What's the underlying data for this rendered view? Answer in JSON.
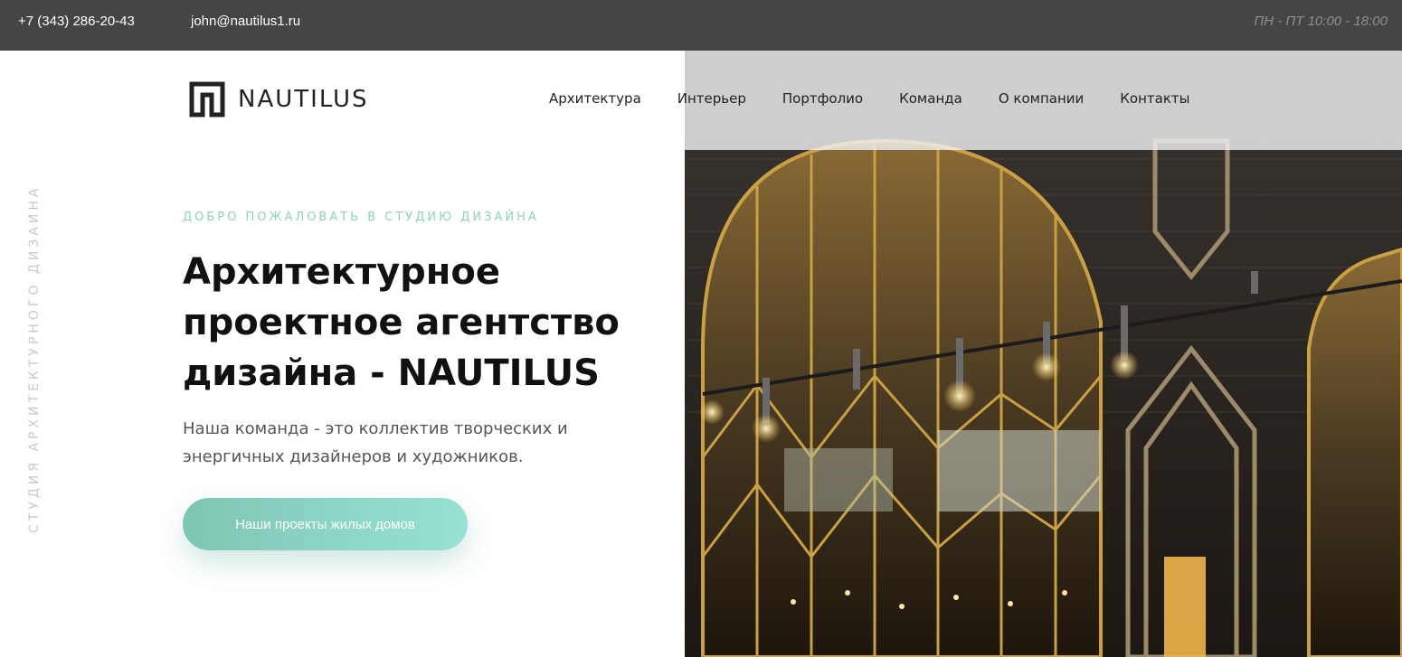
{
  "topbar": {
    "phone": "+7 (343) 286-20-43",
    "email": "john@nautilus1.ru",
    "hours": "ПН - ПТ 10:00 - 18:00"
  },
  "brand": {
    "name": "NAUTILUS",
    "accent_color": "#8ed1c2",
    "topbar_color": "#454545"
  },
  "nav": {
    "items": [
      {
        "label": "Архитектура"
      },
      {
        "label": "Интерьер"
      },
      {
        "label": "Портфолио"
      },
      {
        "label": "Команда"
      },
      {
        "label": "О компании"
      },
      {
        "label": "Контакты"
      }
    ]
  },
  "side": {
    "vertical_text": "СТУДИЯ АРХИТЕКТУРНОГО ДИЗАЙНА"
  },
  "hero": {
    "eyebrow": "ДОБРО ПОЖАЛОВАТЬ В СТУДИЮ ДИЗАЙНА",
    "headline": "Архитектурное проектное агентство дизайна - NAUTILUS",
    "lead": "Наша команда - это коллектив творческих и энергичных дизайнеров и художников.",
    "cta_label": "Наши проекты жилых домов"
  }
}
